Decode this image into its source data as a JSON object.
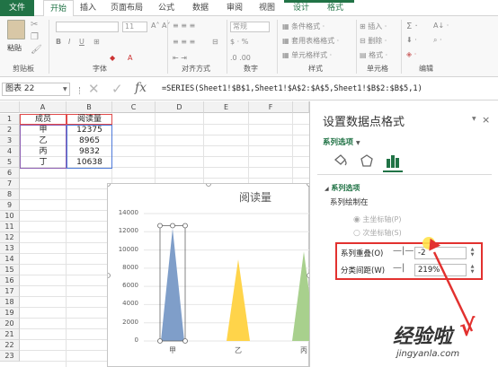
{
  "tabs": [
    "文件",
    "开始",
    "插入",
    "页面布局",
    "公式",
    "数据",
    "审阅",
    "视图",
    "设计",
    "格式"
  ],
  "ribbon": {
    "groups": [
      "剪贴板",
      "字体",
      "对齐方式",
      "数字",
      "样式",
      "单元格",
      "编辑"
    ],
    "paste_label": "粘贴",
    "font_size": "11",
    "number_format": "常规",
    "styles": [
      "条件格式 ·",
      "套用表格格式 ·",
      "单元格样式 ·"
    ],
    "cells": [
      "插入 ·",
      "删除 ·",
      "格式 ·"
    ]
  },
  "formula_bar": {
    "name_box": "图表 22",
    "fx": "fx",
    "formula": "=SERIES(Sheet1!$B$1,Sheet1!$A$2:$A$5,Sheet1!$B$2:$B$5,1)"
  },
  "sheet": {
    "columns": [
      "A",
      "B",
      "C",
      "D",
      "E",
      "F"
    ],
    "rows": [
      "1",
      "2",
      "3",
      "4",
      "5",
      "6",
      "7",
      "8",
      "9",
      "10",
      "11",
      "12",
      "13",
      "14",
      "15",
      "16",
      "17",
      "18",
      "19",
      "20",
      "21",
      "22",
      "23"
    ],
    "cells": [
      [
        "成员",
        "阅读量"
      ],
      [
        "甲",
        "12375"
      ],
      [
        "乙",
        "8965"
      ],
      [
        "丙",
        "9832"
      ],
      [
        "丁",
        "10638"
      ]
    ]
  },
  "chart_data": {
    "type": "bar",
    "title": "阅读量",
    "categories": [
      "甲",
      "乙",
      "丙"
    ],
    "values": [
      12375,
      8965,
      9832
    ],
    "ylim": [
      0,
      14000
    ],
    "yticks": [
      "14000",
      "12000",
      "10000",
      "8000",
      "6000",
      "4000",
      "2000",
      "0"
    ],
    "colors": [
      "#7f9ec9",
      "#ffd44a",
      "#a8d08d"
    ]
  },
  "pane": {
    "title": "设置数据点格式",
    "close": "×",
    "series_options_dropdown": "系列选项",
    "section": "系列选项",
    "plot_on": "系列绘制在",
    "primary_axis": "主坐标轴(P)",
    "secondary_axis": "次坐标轴(S)",
    "overlap_label": "系列重叠(O)",
    "overlap_value": "-2",
    "gap_label": "分类间距(W)",
    "gap_value": "219%"
  },
  "watermark": {
    "line1": "经验啦",
    "check": "√",
    "line2": "jingyanla.com"
  },
  "accent": "#217346",
  "highlight_red": "#e2312f"
}
